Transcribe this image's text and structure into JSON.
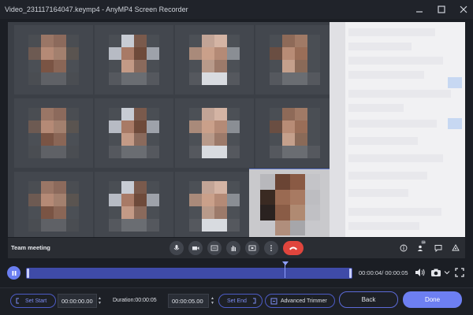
{
  "window": {
    "title": "Video_231117164047.keymp4 - AnyMP4 Screen Recorder"
  },
  "meeting": {
    "title": "Team meeting",
    "participants_badge": "28"
  },
  "player": {
    "time_readout": "00:00:04/ 00:00:05"
  },
  "trim": {
    "set_start_label": "Set Start",
    "start_time": "00:00:00.00",
    "duration_label": "Duration:00:00:05",
    "end_time": "00:00:05.00",
    "set_end_label": "Set End",
    "advanced_trimmer_label": "Advanced Trimmer"
  },
  "actions": {
    "back_label": "Back",
    "done_label": "Done"
  },
  "colors": {
    "accent": "#6d7ff2",
    "hangup": "#e0453d",
    "timeline": "#3f4ba8"
  }
}
